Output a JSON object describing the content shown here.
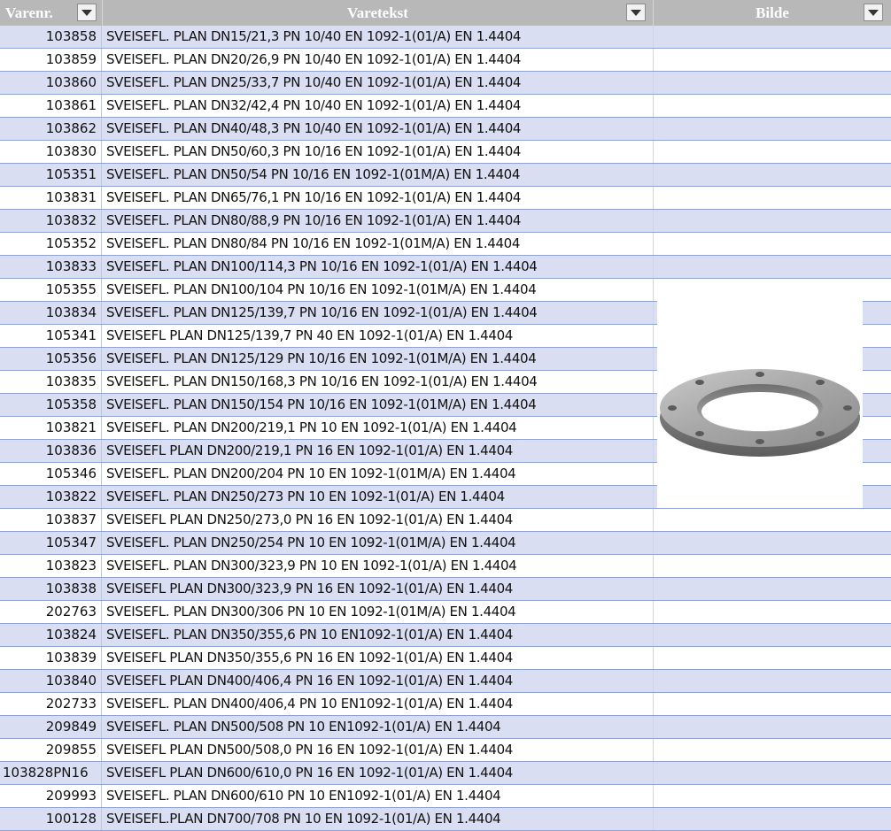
{
  "header": {
    "col_varenr": "Varenr.",
    "col_varetekst": "Varetekst",
    "col_bilde": "Bilde"
  },
  "colors": {
    "header_bg": "#b8b8b8",
    "band_row": "#d9def2",
    "row_border": "#8ea2d6"
  },
  "image": {
    "icon": "flange-photo-icon"
  },
  "rows": [
    {
      "nr": "103858",
      "text": "SVEISEFL. PLAN DN15/21,3 PN 10/40 EN 1092-1(01/A) EN 1.4404"
    },
    {
      "nr": "103859",
      "text": "SVEISEFL. PLAN DN20/26,9 PN 10/40 EN 1092-1(01/A) EN 1.4404"
    },
    {
      "nr": "103860",
      "text": "SVEISEFL. PLAN DN25/33,7 PN 10/40 EN 1092-1(01/A) EN 1.4404"
    },
    {
      "nr": "103861",
      "text": "SVEISEFL. PLAN DN32/42,4 PN 10/40 EN 1092-1(01/A) EN 1.4404"
    },
    {
      "nr": "103862",
      "text": "SVEISEFL. PLAN DN40/48,3 PN 10/40 EN 1092-1(01/A) EN 1.4404"
    },
    {
      "nr": "103830",
      "text": "SVEISEFL. PLAN DN50/60,3 PN 10/16 EN 1092-1(01/A) EN 1.4404"
    },
    {
      "nr": "105351",
      "text": "SVEISEFL. PLAN DN50/54 PN 10/16 EN 1092-1(01M/A) EN 1.4404"
    },
    {
      "nr": "103831",
      "text": "SVEISEFL. PLAN DN65/76,1 PN 10/16 EN 1092-1(01/A) EN 1.4404"
    },
    {
      "nr": "103832",
      "text": "SVEISEFL. PLAN DN80/88,9 PN 10/16 EN 1092-1(01/A) EN 1.4404"
    },
    {
      "nr": "105352",
      "text": "SVEISEFL. PLAN DN80/84 PN 10/16 EN 1092-1(01M/A) EN 1.4404"
    },
    {
      "nr": "103833",
      "text": "SVEISEFL. PLAN DN100/114,3 PN 10/16 EN 1092-1(01/A) EN 1.4404"
    },
    {
      "nr": "105355",
      "text": "SVEISEFL. PLAN DN100/104 PN 10/16 EN 1092-1(01M/A) EN 1.4404"
    },
    {
      "nr": "103834",
      "text": "SVEISEFL. PLAN DN125/139,7 PN 10/16 EN 1092-1(01/A) EN 1.4404"
    },
    {
      "nr": "105341",
      "text": "SVEISEFL PLAN DN125/139,7 PN 40 EN 1092-1(01/A) EN 1.4404"
    },
    {
      "nr": "105356",
      "text": "SVEISEFL. PLAN DN125/129 PN 10/16 EN 1092-1(01M/A) EN 1.4404"
    },
    {
      "nr": "103835",
      "text": "SVEISEFL. PLAN DN150/168,3 PN 10/16 EN 1092-1(01/A) EN 1.4404"
    },
    {
      "nr": "105358",
      "text": "SVEISEFL. PLAN DN150/154 PN 10/16 EN 1092-1(01M/A) EN 1.4404"
    },
    {
      "nr": "103821",
      "text": "SVEISEFL. PLAN DN200/219,1 PN 10 EN 1092-1(01/A) EN 1.4404"
    },
    {
      "nr": "103836",
      "text": "SVEISEFL PLAN DN200/219,1 PN 16 EN 1092-1(01/A) EN 1.4404"
    },
    {
      "nr": "105346",
      "text": "SVEISEFL. PLAN DN200/204 PN 10 EN 1092-1(01M/A) EN 1.4404"
    },
    {
      "nr": "103822",
      "text": "SVEISEFL. PLAN DN250/273 PN 10 EN 1092-1(01/A) EN 1.4404"
    },
    {
      "nr": "103837",
      "text": "SVEISEFL PLAN DN250/273,0 PN 16 EN 1092-1(01/A) EN 1.4404"
    },
    {
      "nr": "105347",
      "text": "SVEISEFL. PLAN DN250/254 PN 10 EN 1092-1(01M/A) EN 1.4404"
    },
    {
      "nr": "103823",
      "text": "SVEISEFL. PLAN DN300/323,9 PN 10 EN 1092-1(01/A) EN 1.4404"
    },
    {
      "nr": "103838",
      "text": "SVEISEFL PLAN DN300/323,9 PN 16 EN 1092-1(01/A) EN 1.4404"
    },
    {
      "nr": "202763",
      "text": "SVEISEFL. PLAN DN300/306 PN 10 EN 1092-1(01M/A) EN 1.4404"
    },
    {
      "nr": "103824",
      "text": "SVEISEFL. PLAN DN350/355,6 PN 10 EN1092-1(01/A) EN 1.4404"
    },
    {
      "nr": "103839",
      "text": "SVEISEFL PLAN DN350/355,6 PN 16 EN 1092-1(01/A) EN 1.4404"
    },
    {
      "nr": "103840",
      "text": "SVEISEFL PLAN DN400/406,4 PN 16 EN 1092-1(01/A) EN 1.4404"
    },
    {
      "nr": "202733",
      "text": "SVEISEFL. PLAN DN400/406,4 PN 10 EN1092-1(01/A) EN 1.4404"
    },
    {
      "nr": "209849",
      "text": "SVEISEFL. PLAN DN500/508 PN 10 EN1092-1(01/A) EN 1.4404"
    },
    {
      "nr": "209855",
      "text": "SVEISEFL PLAN DN500/508,0 PN 16 EN 1092-1(01/A) EN 1.4404"
    },
    {
      "nr": "103828PN16",
      "text": "SVEISEFL PLAN DN600/610,0 PN 16 EN 1092-1(01/A) EN 1.4404"
    },
    {
      "nr": "209993",
      "text": "SVEISEFL. PLAN DN600/610 PN 10 EN1092-1(01/A) EN 1.4404"
    },
    {
      "nr": "100128",
      "text": "SVEISEFL.PLAN DN700/708 PN 10 EN 1092-1(01/A) EN 1.4404"
    }
  ]
}
